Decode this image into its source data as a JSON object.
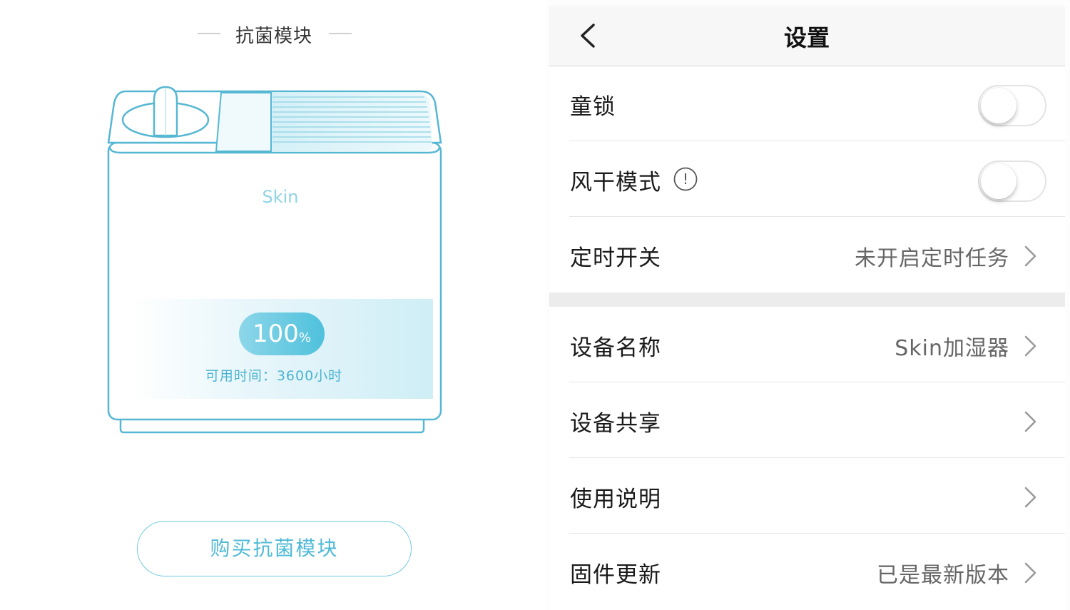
{
  "left": {
    "section_title": "抗菌模块",
    "device_brand": "Skin",
    "module_percent": "100",
    "percent_unit": "%",
    "module_percent_value": 100,
    "remaining_time_text": "可用时间：3600小时",
    "buy_button_label": "购买抗菌模块",
    "accent_color": "#4fbad6"
  },
  "settings": {
    "title": "设置",
    "back_icon": "chevron-left-icon",
    "rows": [
      {
        "label": "童锁",
        "control": "toggle",
        "checked": false
      },
      {
        "label": "风干模式",
        "control": "toggle",
        "checked": false,
        "info_icon": "info-icon",
        "info_symbol": "!"
      },
      {
        "label": "定时开关",
        "value": "未开启定时任务",
        "control": "chevron"
      },
      {
        "label": "设备名称",
        "value": "Skin加湿器",
        "control": "chevron"
      },
      {
        "label": "设备共享",
        "value": "",
        "control": "chevron"
      },
      {
        "label": "使用说明",
        "value": "",
        "control": "chevron"
      },
      {
        "label": "固件更新",
        "value": "已是最新版本",
        "control": "chevron"
      }
    ]
  }
}
